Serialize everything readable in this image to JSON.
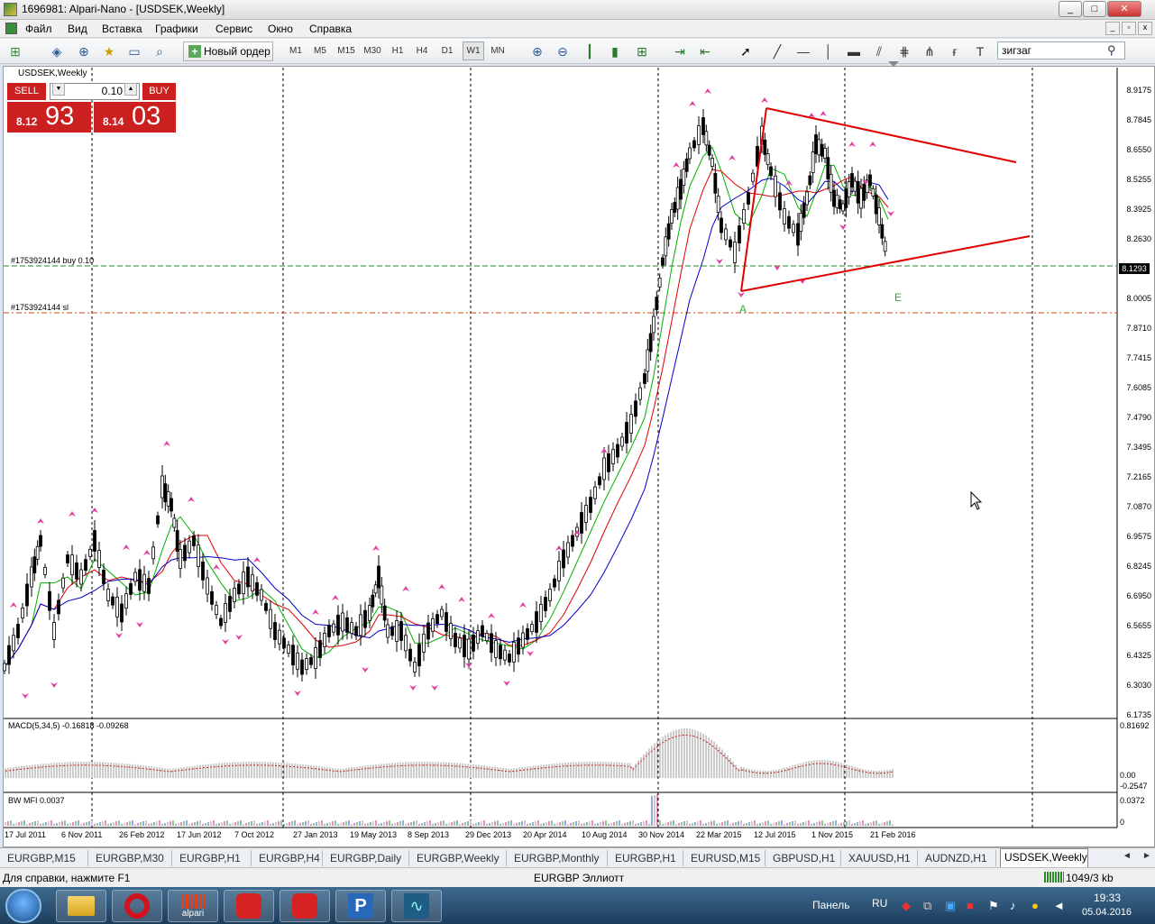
{
  "window": {
    "title": "1696981: Alpari-Nano - [USDSEK,Weekly]",
    "controls": [
      "_",
      "□",
      "✕"
    ]
  },
  "menu": [
    "Файл",
    "Вид",
    "Вставка",
    "Графики",
    "Сервис",
    "Окно",
    "Справка"
  ],
  "toolbar": {
    "new_order": "Новый ордер",
    "timeframes": [
      "M1",
      "M5",
      "M15",
      "M30",
      "H1",
      "H4",
      "D1",
      "W1",
      "MN"
    ],
    "active_timeframe": "W1",
    "search_value": "зигзаг"
  },
  "chart": {
    "symbol": "USDSEK,Weekly",
    "trade_panel": {
      "sell_label": "SELL",
      "buy_label": "BUY",
      "lot": "0.10",
      "sell_small": "8.12",
      "sell_big": "93",
      "buy_small": "8.14",
      "buy_big": "03"
    },
    "order_label": "#1753924144 buy 0.10",
    "sl_label": "#1753924144 sl",
    "current_price": "8.1293",
    "price_ticks": [
      "8.9175",
      "8.7845",
      "8.6550",
      "8.5255",
      "8.3925",
      "8.2630",
      "8.1293",
      "8.0005",
      "7.8710",
      "7.7415",
      "7.6085",
      "7.4790",
      "7.3495",
      "7.2165",
      "7.0870",
      "6.9575",
      "6.8245",
      "6.6950",
      "6.5655",
      "6.4325",
      "6.3030",
      "6.1735"
    ],
    "wave_labels": [
      "A",
      "E"
    ],
    "macd_label": "MACD(5,34,5) -0.16818 -0.09268",
    "macd_ticks": [
      "0.81692",
      "0.00",
      "-0.2547"
    ],
    "mfi_label": "BW MFI 0.0037",
    "mfi_ticks": [
      "0.0372",
      "0"
    ],
    "date_labels": [
      "17 Jul 2011",
      "6 Nov 2011",
      "26 Feb 2012",
      "17 Jun 2012",
      "7 Oct 2012",
      "27 Jan 2013",
      "19 May 2013",
      "8 Sep 2013",
      "29 Dec 2013",
      "20 Apr 2014",
      "10 Aug 2014",
      "30 Nov 2014",
      "22 Mar 2015",
      "12 Jul 2015",
      "1 Nov 2015",
      "21 Feb 2016"
    ]
  },
  "tabs": [
    "EURGBP,M15",
    "EURGBP,M30",
    "EURGBP,H1",
    "EURGBP,H4",
    "EURGBP,Daily",
    "EURGBP,Weekly",
    "EURGBP,Monthly",
    "EURGBP,H1",
    "EURUSD,M15",
    "GBPUSD,H1",
    "XAUUSD,H1",
    "AUDNZD,H1",
    "USDSEK,Weekly"
  ],
  "status": {
    "help": "Для справки, нажмите F1",
    "profile": "EURGBP Эллиотт",
    "traffic": "1049/3 kb"
  },
  "taskbar": {
    "apps": [
      "folder",
      "opera",
      "alpari",
      "metatrader-1",
      "metatrader-2",
      "p-app",
      "stock-app"
    ],
    "alpari_label": "alpari",
    "panel": "Панель",
    "lang": "RU",
    "time": "19:33",
    "date": "05.04.2016"
  },
  "colors": {
    "sell_buy": "#cc1f1f",
    "zigzag_arrows": "#e040a0",
    "ma_red": "#e00000",
    "ma_green": "#00b000",
    "ma_blue": "#0000cc",
    "triangle": "#e00000",
    "wave_label": "#33aa33"
  }
}
